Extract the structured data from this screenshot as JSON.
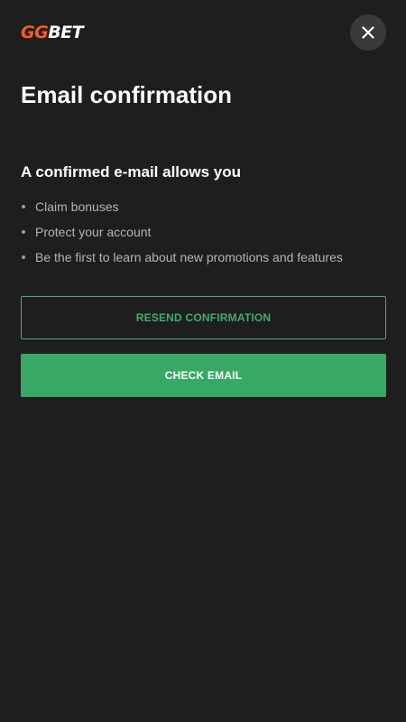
{
  "brand": {
    "logo_part1": "GG",
    "logo_part2": "BET"
  },
  "colors": {
    "background": "#1e1e1e",
    "accent_green": "#38a865",
    "brand_orange": "#ff5a1f",
    "close_button_bg": "#3a3a3a"
  },
  "icons": {
    "close": "close-icon"
  },
  "page": {
    "title": "Email confirmation",
    "subtitle": "A confirmed e-mail allows you",
    "benefits": [
      {
        "label": "Claim bonuses"
      },
      {
        "label": "Protect your account"
      },
      {
        "label": "Be the first to learn about new promotions and features"
      }
    ]
  },
  "actions": {
    "resend_label": "RESEND CONFIRMATION",
    "check_label": "CHECK EMAIL"
  }
}
